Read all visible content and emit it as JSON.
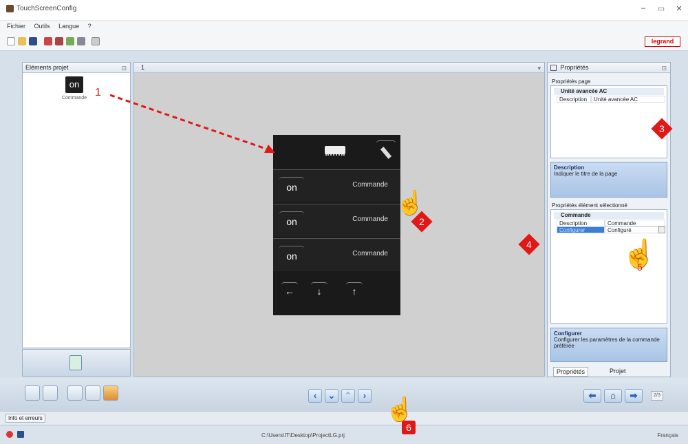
{
  "window": {
    "title": "TouchScreenConfig",
    "minimize": "–",
    "maximize": "▭",
    "close": "✕"
  },
  "menu": [
    "Fichier",
    "Outils",
    "Langue",
    "?"
  ],
  "brand": {
    "logo_text": "legrand",
    "accent": "#d00000"
  },
  "project_panel": {
    "title": "Eléments projet",
    "item_icon_text": "on",
    "item_label": "Commande"
  },
  "editor": {
    "tab": "1",
    "dropdown": "▾"
  },
  "device": {
    "rows": [
      {
        "button": "on",
        "label": "Commande"
      },
      {
        "button": "on",
        "label": "Commande"
      },
      {
        "button": "on",
        "label": "Commande"
      }
    ],
    "arrows": [
      "←",
      "↓",
      "↑"
    ]
  },
  "properties": {
    "title": "Propriétés",
    "page_section": "Propriétés page",
    "page_group": "Unité avancée AC",
    "page_row": {
      "key": "Description",
      "value": "Unité avancée AC"
    },
    "desc_title": "Description",
    "desc_text": "Indiquer le titre de la page",
    "element_section": "Propriétés élément sélectionné",
    "element_group": "Commande",
    "element_rows": [
      {
        "key": "Description",
        "value": "Commande"
      },
      {
        "key": "Configurer",
        "value": "Configuré"
      }
    ],
    "config_title": "Configurer",
    "config_text": "Configurer les paramètres de la commande préférée",
    "tabs": [
      "Propriétés",
      "Projet"
    ]
  },
  "navigation": {
    "page_counter": "2/3"
  },
  "info_tab": "Info et erreurs",
  "status": {
    "path": "C:\\Users\\IT\\Desktop\\ProjectLG.prj",
    "language": "Français"
  },
  "annotations": [
    "1",
    "2",
    "3",
    "4",
    "5",
    "6"
  ]
}
